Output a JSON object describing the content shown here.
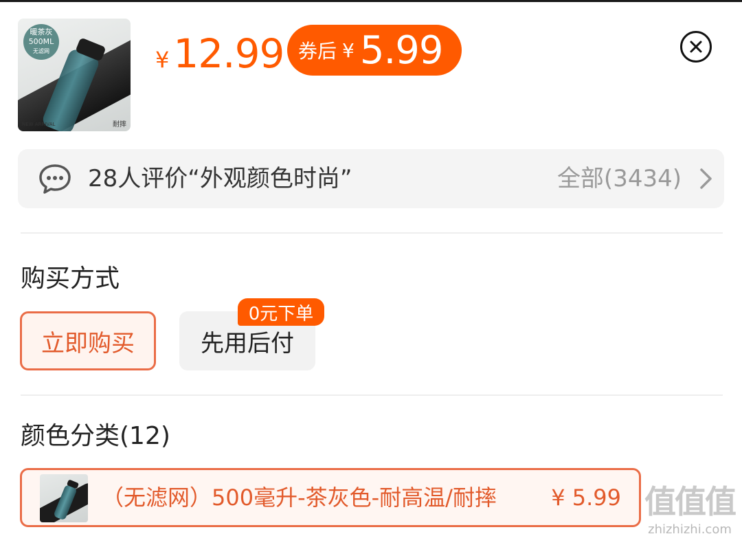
{
  "header": {
    "product_image": {
      "tag_line1": "暖茶灰",
      "tag_line2": "500ML",
      "tag_line3": "无滤网",
      "corner_left": "NEW ARRIVAL",
      "corner_right": "耐摔"
    },
    "price": {
      "currency": "¥",
      "value": "12.99"
    },
    "coupon_price": {
      "label": "券后",
      "currency": "¥",
      "value": "5.99"
    },
    "close_icon": "close-circle-icon"
  },
  "review": {
    "icon": "chat-bubble-icon",
    "summary": "28人评价“外观颜色时尚”",
    "all_label": "全部(3434)",
    "chevron_icon": "chevron-right-icon"
  },
  "purchase": {
    "title": "购买方式",
    "options": [
      {
        "label": "立即购买",
        "selected": true
      },
      {
        "label": "先用后付",
        "badge": "0元下单",
        "selected": false
      }
    ]
  },
  "color": {
    "title": "颜色分类(12)",
    "variants": [
      {
        "name": "（无滤网）500毫升-茶灰色-耐高温/耐摔",
        "price": "¥ 5.99",
        "selected": true
      }
    ]
  },
  "watermark": {
    "logo": "值值值",
    "url": "zhizhizhi.com"
  },
  "colors": {
    "accent": "#ff5a00",
    "selected_border": "#ea6c46",
    "muted_text": "#999999"
  }
}
